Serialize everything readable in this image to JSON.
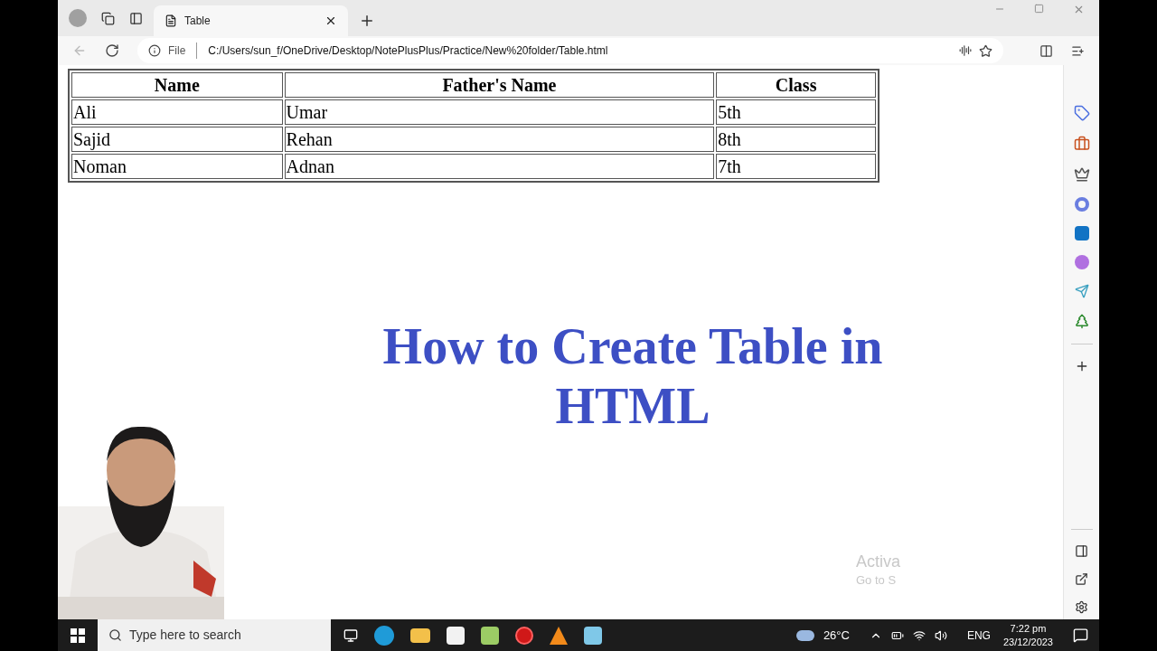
{
  "tabs": [
    {
      "label": "Table",
      "selected": true
    }
  ],
  "address_bar": {
    "scheme": "File",
    "url": "C:/Users/sun_f/OneDrive/Desktop/NotePlusPlus/Practice/New%20folder/Table.html"
  },
  "table": {
    "columns": [
      "Name",
      "Father's Name",
      "Class"
    ],
    "rows": [
      [
        "Ali",
        "Umar",
        "5th"
      ],
      [
        "Sajid",
        "Rehan",
        "8th"
      ],
      [
        "Noman",
        "Adnan",
        "7th"
      ]
    ]
  },
  "overlay_title": "How to Create Table in HTML",
  "activation_notice": {
    "title": "Activa",
    "subtitle": "Go to S"
  },
  "taskbar": {
    "search_placeholder": "Type here to search",
    "weather": "26°C",
    "language": "ENG",
    "time": "7:22 pm",
    "date": "23/12/2023"
  }
}
